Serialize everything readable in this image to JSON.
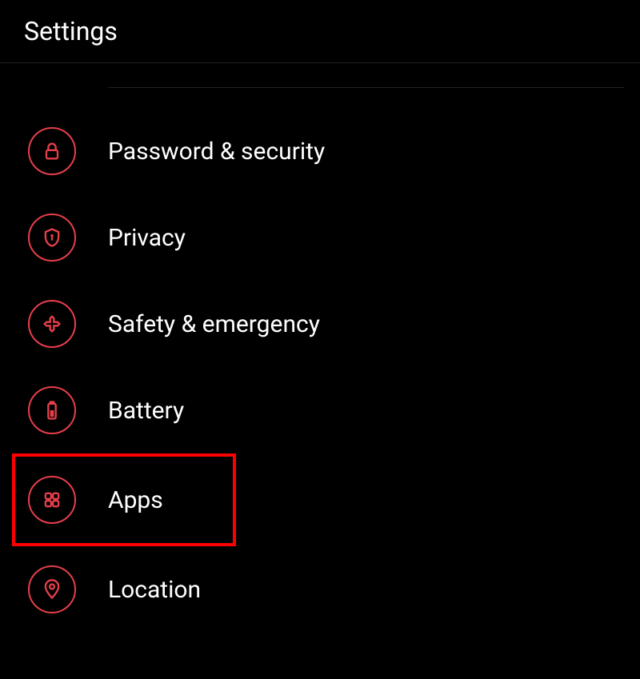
{
  "header": {
    "title": "Settings"
  },
  "accent_color": "#e63f4a",
  "highlight_color": "#ff0000",
  "highlighted_item_index": 4,
  "items": [
    {
      "id": "password-security",
      "icon": "lock-icon",
      "label": "Password & security"
    },
    {
      "id": "privacy",
      "icon": "shield-icon",
      "label": "Privacy"
    },
    {
      "id": "safety-emergency",
      "icon": "medical-icon",
      "label": "Safety & emergency"
    },
    {
      "id": "battery",
      "icon": "battery-icon",
      "label": "Battery"
    },
    {
      "id": "apps",
      "icon": "apps-icon",
      "label": "Apps"
    },
    {
      "id": "location",
      "icon": "location-icon",
      "label": "Location"
    }
  ]
}
